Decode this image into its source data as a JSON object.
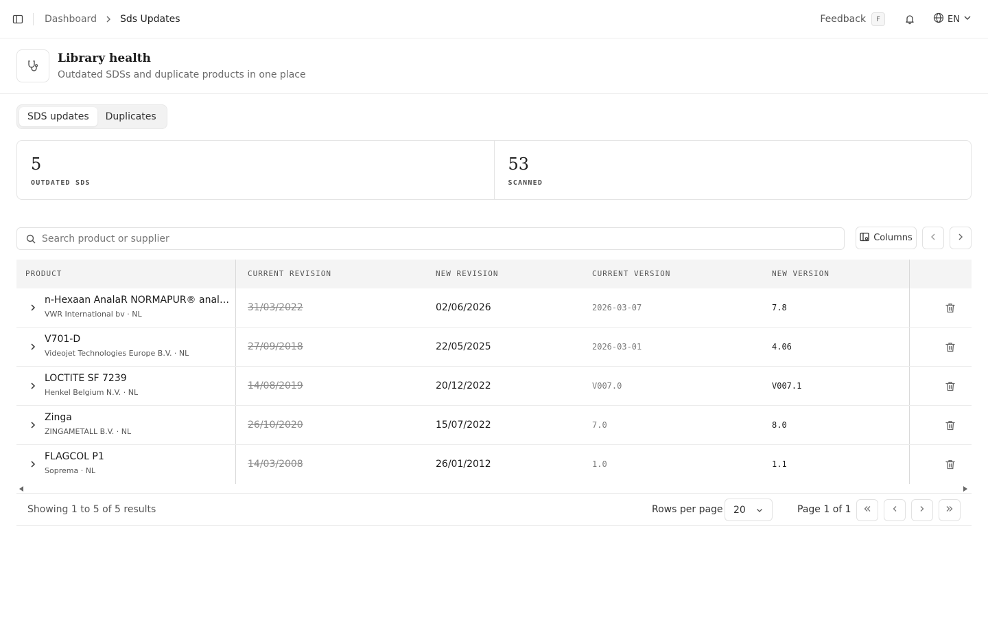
{
  "topbar": {
    "breadcrumb": {
      "parent": "Dashboard",
      "current": "Sds Updates"
    },
    "feedback_label": "Feedback",
    "feedback_shortcut": "F",
    "language": "EN"
  },
  "header": {
    "title": "Library health",
    "subtitle": "Outdated SDSs and duplicate products in one place"
  },
  "tabs": [
    {
      "label": "SDS updates",
      "active": true
    },
    {
      "label": "Duplicates",
      "active": false
    }
  ],
  "stats": [
    {
      "value": "5",
      "label": "OUTDATED SDS"
    },
    {
      "value": "53",
      "label": "SCANNED"
    }
  ],
  "toolbar": {
    "search_placeholder": "Search product or supplier",
    "columns_label": "Columns"
  },
  "table": {
    "columns": [
      "PRODUCT",
      "CURRENT REVISION",
      "NEW REVISION",
      "CURRENT VERSION",
      "NEW VERSION"
    ],
    "rows": [
      {
        "name": "n-Hexaan AnalaR NORMAPUR® analytical reagent",
        "supplier": "VWR International bv · NL",
        "current_revision": "31/03/2022",
        "new_revision": "02/06/2026",
        "current_version": "2026-03-07",
        "new_version": "7.8"
      },
      {
        "name": "V701-D",
        "supplier": "Videojet Technologies Europe B.V. · NL",
        "current_revision": "27/09/2018",
        "new_revision": "22/05/2025",
        "current_version": "2026-03-01",
        "new_version": "4.06"
      },
      {
        "name": "LOCTITE SF 7239",
        "supplier": "Henkel Belgium N.V. · NL",
        "current_revision": "14/08/2019",
        "new_revision": "20/12/2022",
        "current_version": "V007.0",
        "new_version": "V007.1"
      },
      {
        "name": "Zinga",
        "supplier": "ZINGAMETALL B.V. · NL",
        "current_revision": "26/10/2020",
        "new_revision": "15/07/2022",
        "current_version": "7.0",
        "new_version": "8.0"
      },
      {
        "name": "FLAGCOL P1",
        "supplier": "Soprema · NL",
        "current_revision": "14/03/2008",
        "new_revision": "26/01/2012",
        "current_version": "1.0",
        "new_version": "1.1"
      }
    ]
  },
  "footer": {
    "showing": "Showing 1 to 5 of 5 results",
    "rows_per_page_label": "Rows per page",
    "rows_per_page_value": "20",
    "page_info": "Page 1 of 1"
  },
  "icons": {
    "sidebar_toggle": "sidebar-toggle-icon",
    "header": "stethoscope-icon",
    "bell": "bell-icon",
    "globe": "globe-icon",
    "search": "search-icon",
    "columns": "columns-icon",
    "delete": "trash-icon"
  }
}
